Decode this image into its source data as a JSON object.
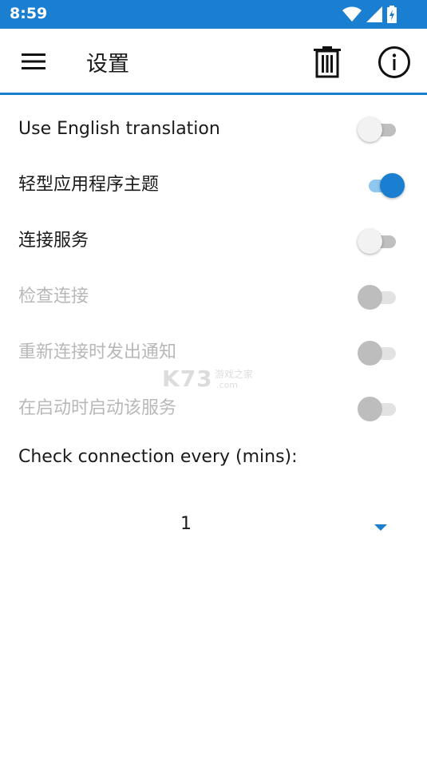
{
  "status_bar": {
    "time": "8:59",
    "icons": [
      "wifi-icon",
      "signal-icon",
      "battery-charging-icon"
    ],
    "color": "#1a7fd1"
  },
  "app_bar": {
    "title": "设置",
    "menu_icon": "menu-icon",
    "delete_icon": "trash-icon",
    "info_icon": "info-icon",
    "accent": "#1a7fd1"
  },
  "settings": [
    {
      "label": "Use English translation",
      "on": false,
      "enabled": true
    },
    {
      "label": "轻型应用程序主题",
      "on": true,
      "enabled": true
    },
    {
      "label": "连接服务",
      "on": false,
      "enabled": true
    },
    {
      "label": "检查连接",
      "on": false,
      "enabled": false
    },
    {
      "label": "重新连接时发出通知",
      "on": false,
      "enabled": false
    },
    {
      "label": "在启动时启动该服务",
      "on": false,
      "enabled": false
    }
  ],
  "interval": {
    "label": "Check connection every (mins):",
    "value": "1"
  },
  "watermark": {
    "main": "K73",
    "line1": "游戏之家",
    "line2": ".com"
  }
}
